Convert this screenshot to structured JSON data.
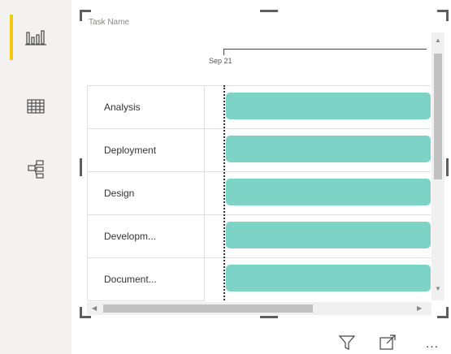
{
  "visual": {
    "title": "Task Name",
    "timeline_label": "Sep 21",
    "bar_color": "#7dd3c6",
    "tasks": [
      {
        "label": "Analysis"
      },
      {
        "label": "Deployment"
      },
      {
        "label": "Design"
      },
      {
        "label": "Developm..."
      },
      {
        "label": "Document..."
      }
    ]
  },
  "rail": {
    "items": [
      {
        "icon": "bar-chart-icon",
        "active": true
      },
      {
        "icon": "table-icon",
        "active": false
      },
      {
        "icon": "model-icon",
        "active": false
      }
    ],
    "accent": "#f2c811"
  },
  "toolbar": {
    "filter_icon": "filter-icon",
    "focus_icon": "focus-mode-icon",
    "more_label": "..."
  }
}
